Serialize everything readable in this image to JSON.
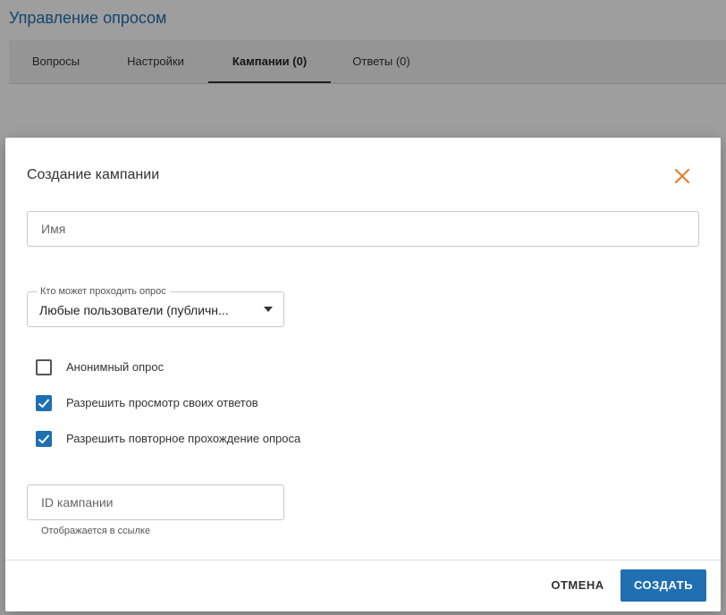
{
  "page": {
    "title": "Управление опросом",
    "tabs": [
      {
        "label": "Вопросы",
        "active": false
      },
      {
        "label": "Настройки",
        "active": false
      },
      {
        "label": "Кампании (0)",
        "active": true
      },
      {
        "label": "Ответы (0)",
        "active": false
      }
    ]
  },
  "dialog": {
    "title": "Создание кампании",
    "close_icon": "close-icon",
    "name_field": {
      "placeholder": "Имя",
      "value": ""
    },
    "access_select": {
      "legend": "Кто может проходить опрос",
      "selected": "Любые пользователи (публичн..."
    },
    "checkboxes": [
      {
        "label": "Анонимный опрос",
        "checked": false
      },
      {
        "label": "Разрешить просмотр своих ответов",
        "checked": true
      },
      {
        "label": "Разрешить повторное прохождение опроса",
        "checked": true
      }
    ],
    "campaign_id_field": {
      "placeholder": "ID кампании",
      "value": "",
      "helper": "Отображается в ссылке"
    },
    "cancel_label": "ОТМЕНА",
    "create_label": "СОЗДАТЬ"
  },
  "colors": {
    "accent": "#1f6fb2",
    "close_icon": "#e8791e"
  }
}
